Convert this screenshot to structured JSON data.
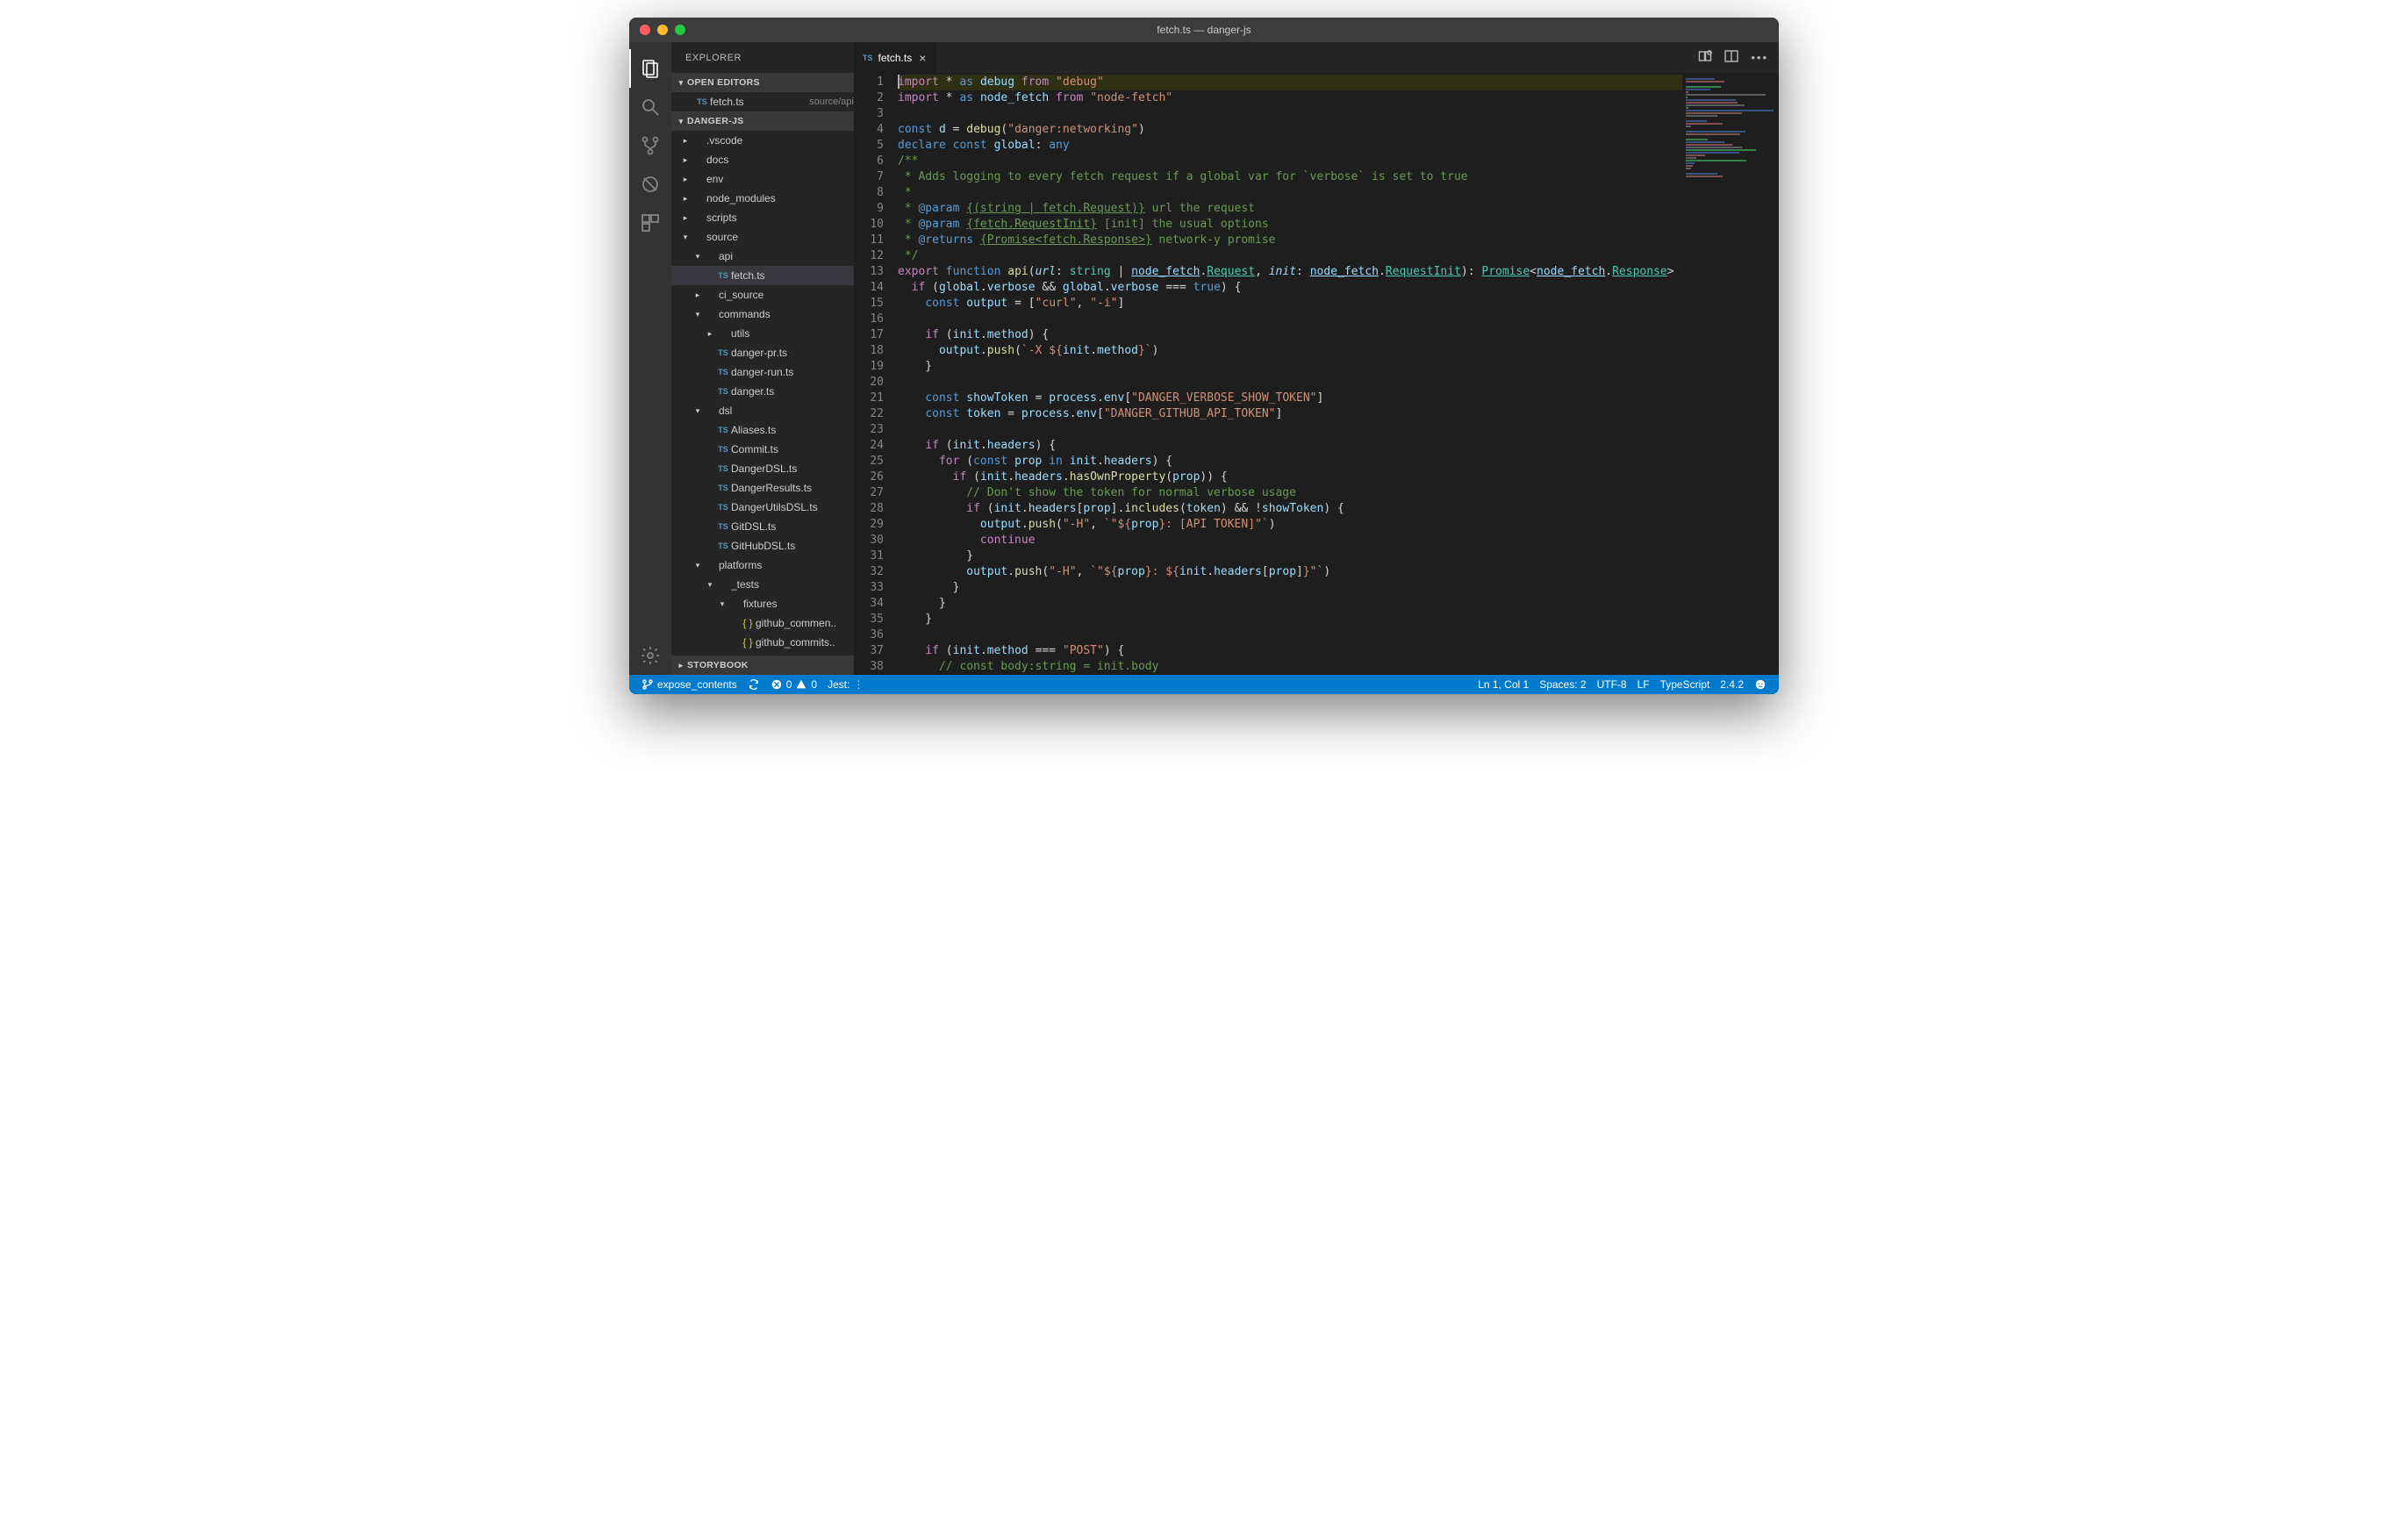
{
  "window": {
    "title": "fetch.ts — danger-js"
  },
  "sidebar": {
    "title": "EXPLORER",
    "sections": {
      "open_editors": {
        "label": "OPEN EDITORS",
        "items": [
          {
            "icon": "ts",
            "name": "fetch.ts",
            "path": "source/api"
          }
        ]
      },
      "project": {
        "label": "DANGER-JS"
      },
      "storybook": {
        "label": "STORYBOOK"
      }
    },
    "tree": [
      {
        "depth": 0,
        "kind": "folder",
        "open": false,
        "name": ".vscode"
      },
      {
        "depth": 0,
        "kind": "folder",
        "open": false,
        "name": "docs"
      },
      {
        "depth": 0,
        "kind": "folder",
        "open": false,
        "name": "env"
      },
      {
        "depth": 0,
        "kind": "folder",
        "open": false,
        "name": "node_modules"
      },
      {
        "depth": 0,
        "kind": "folder",
        "open": false,
        "name": "scripts"
      },
      {
        "depth": 0,
        "kind": "folder",
        "open": true,
        "name": "source"
      },
      {
        "depth": 1,
        "kind": "folder",
        "open": true,
        "name": "api"
      },
      {
        "depth": 2,
        "kind": "file",
        "icon": "ts",
        "name": "fetch.ts",
        "selected": true
      },
      {
        "depth": 1,
        "kind": "folder",
        "open": false,
        "name": "ci_source"
      },
      {
        "depth": 1,
        "kind": "folder",
        "open": true,
        "name": "commands"
      },
      {
        "depth": 2,
        "kind": "folder",
        "open": false,
        "name": "utils"
      },
      {
        "depth": 2,
        "kind": "file",
        "icon": "ts",
        "name": "danger-pr.ts"
      },
      {
        "depth": 2,
        "kind": "file",
        "icon": "ts",
        "name": "danger-run.ts"
      },
      {
        "depth": 2,
        "kind": "file",
        "icon": "ts",
        "name": "danger.ts"
      },
      {
        "depth": 1,
        "kind": "folder",
        "open": true,
        "name": "dsl"
      },
      {
        "depth": 2,
        "kind": "file",
        "icon": "ts",
        "name": "Aliases.ts"
      },
      {
        "depth": 2,
        "kind": "file",
        "icon": "ts",
        "name": "Commit.ts"
      },
      {
        "depth": 2,
        "kind": "file",
        "icon": "ts",
        "name": "DangerDSL.ts"
      },
      {
        "depth": 2,
        "kind": "file",
        "icon": "ts",
        "name": "DangerResults.ts"
      },
      {
        "depth": 2,
        "kind": "file",
        "icon": "ts",
        "name": "DangerUtilsDSL.ts"
      },
      {
        "depth": 2,
        "kind": "file",
        "icon": "ts",
        "name": "GitDSL.ts"
      },
      {
        "depth": 2,
        "kind": "file",
        "icon": "ts",
        "name": "GitHubDSL.ts"
      },
      {
        "depth": 1,
        "kind": "folder",
        "open": true,
        "name": "platforms"
      },
      {
        "depth": 2,
        "kind": "folder",
        "open": true,
        "name": "_tests"
      },
      {
        "depth": 3,
        "kind": "folder",
        "open": true,
        "name": "fixtures"
      },
      {
        "depth": 4,
        "kind": "file",
        "icon": "json",
        "name": "github_commen.."
      },
      {
        "depth": 4,
        "kind": "file",
        "icon": "json",
        "name": "github_commits.."
      }
    ]
  },
  "tabs": {
    "open": [
      {
        "icon": "ts",
        "name": "fetch.ts",
        "active": true
      }
    ]
  },
  "editor": {
    "lines": [
      {
        "n": 1,
        "hl": true,
        "html": "<span class='cursor'></span><span class='t-k'>import</span> <span class='t-op'>*</span> <span class='t-kw2'>as</span> <span class='t-v'>debug</span> <span class='t-k'>from</span> <span class='t-s'>\"debug\"</span>"
      },
      {
        "n": 2,
        "html": "<span class='t-k'>import</span> <span class='t-op'>*</span> <span class='t-kw2'>as</span> <span class='t-v'>node_fetch</span> <span class='t-k'>from</span> <span class='t-s'>\"node-fetch\"</span>"
      },
      {
        "n": 3,
        "html": ""
      },
      {
        "n": 4,
        "html": "<span class='t-kw2'>const</span> <span class='t-v'>d</span> <span class='t-op'>=</span> <span class='t-fn'>debug</span>(<span class='t-s'>\"danger:networking\"</span>)"
      },
      {
        "n": 5,
        "html": "<span class='t-kw2'>declare</span> <span class='t-kw2'>const</span> <span class='t-v'>global</span>: <span class='t-kw2'>any</span>"
      },
      {
        "n": 6,
        "html": "<span class='t-c'>/**</span>"
      },
      {
        "n": 7,
        "html": "<span class='t-c'> * Adds logging to every fetch request if a global var for `verbose` is set to true</span>"
      },
      {
        "n": 8,
        "html": "<span class='t-c'> *</span>"
      },
      {
        "n": 9,
        "html": "<span class='t-c'> * <span class='t-doctag'>@param</span> <span class='t-u'>{(string | fetch.Request)}</span> url the request</span>"
      },
      {
        "n": 10,
        "html": "<span class='t-c'> * <span class='t-doctag'>@param</span> <span class='t-u'>{fetch.RequestInit}</span> [init] the usual options</span>"
      },
      {
        "n": 11,
        "html": "<span class='t-c'> * <span class='t-doctag'>@returns</span> <span class='t-u'>{Promise&lt;fetch.Response&gt;}</span> network-y promise</span>"
      },
      {
        "n": 12,
        "html": "<span class='t-c'> */</span>"
      },
      {
        "n": 13,
        "html": "<span class='t-k'>export</span> <span class='t-kw2'>function</span> <span class='t-fn'>api</span>(<span class='t-v t-it'>url</span>: <span class='t-ty'>string</span> | <span class='t-v t-u'>node_fetch</span>.<span class='t-ty t-u'>Request</span>, <span class='t-v t-it'>init</span>: <span class='t-v t-u'>node_fetch</span>.<span class='t-ty t-u'>RequestInit</span>): <span class='t-ty t-u'>Promise</span>&lt;<span class='t-v t-u'>node_fetch</span>.<span class='t-ty t-u'>Response</span>&gt; <span class='t-br'>{</span>"
      },
      {
        "n": 14,
        "html": "  <span class='t-k'>if</span> (<span class='t-v'>global</span>.<span class='t-v'>verbose</span> <span class='t-op'>&amp;&amp;</span> <span class='t-v'>global</span>.<span class='t-v'>verbose</span> <span class='t-op'>===</span> <span class='t-kw2'>true</span>) {"
      },
      {
        "n": 15,
        "html": "    <span class='t-kw2'>const</span> <span class='t-v'>output</span> <span class='t-op'>=</span> [<span class='t-s'>\"curl\"</span>, <span class='t-s'>\"-i\"</span>]"
      },
      {
        "n": 16,
        "html": ""
      },
      {
        "n": 17,
        "html": "    <span class='t-k'>if</span> (<span class='t-v'>init</span>.<span class='t-v'>method</span>) {"
      },
      {
        "n": 18,
        "html": "      <span class='t-v'>output</span>.<span class='t-fn'>push</span>(<span class='t-s'>`-X ${</span><span class='t-v'>init</span>.<span class='t-v'>method</span><span class='t-s'>}`</span>)"
      },
      {
        "n": 19,
        "html": "    }"
      },
      {
        "n": 20,
        "html": ""
      },
      {
        "n": 21,
        "html": "    <span class='t-kw2'>const</span> <span class='t-v'>showToken</span> <span class='t-op'>=</span> <span class='t-v'>process</span>.<span class='t-v'>env</span>[<span class='t-s'>\"DANGER_VERBOSE_SHOW_TOKEN\"</span>]"
      },
      {
        "n": 22,
        "html": "    <span class='t-kw2'>const</span> <span class='t-v'>token</span> <span class='t-op'>=</span> <span class='t-v'>process</span>.<span class='t-v'>env</span>[<span class='t-s'>\"DANGER_GITHUB_API_TOKEN\"</span>]"
      },
      {
        "n": 23,
        "html": ""
      },
      {
        "n": 24,
        "html": "    <span class='t-k'>if</span> (<span class='t-v'>init</span>.<span class='t-v'>headers</span>) {"
      },
      {
        "n": 25,
        "html": "      <span class='t-k'>for</span> (<span class='t-kw2'>const</span> <span class='t-v'>prop</span> <span class='t-kw2'>in</span> <span class='t-v'>init</span>.<span class='t-v'>headers</span>) {"
      },
      {
        "n": 26,
        "html": "        <span class='t-k'>if</span> (<span class='t-v'>init</span>.<span class='t-v'>headers</span>.<span class='t-fn'>hasOwnProperty</span>(<span class='t-v'>prop</span>)) {"
      },
      {
        "n": 27,
        "html": "          <span class='t-c'>// Don't show the token for normal verbose usage</span>"
      },
      {
        "n": 28,
        "html": "          <span class='t-k'>if</span> (<span class='t-v'>init</span>.<span class='t-v'>headers</span>[<span class='t-v'>prop</span>].<span class='t-fn'>includes</span>(<span class='t-v'>token</span>) <span class='t-op'>&amp;&amp;</span> !<span class='t-v'>showToken</span>) {"
      },
      {
        "n": 29,
        "html": "            <span class='t-v'>output</span>.<span class='t-fn'>push</span>(<span class='t-s'>\"-H\"</span>, <span class='t-s'>`\"${</span><span class='t-v'>prop</span><span class='t-s'>}: [API TOKEN]\"`</span>)"
      },
      {
        "n": 30,
        "html": "            <span class='t-k'>continue</span>"
      },
      {
        "n": 31,
        "html": "          }"
      },
      {
        "n": 32,
        "html": "          <span class='t-v'>output</span>.<span class='t-fn'>push</span>(<span class='t-s'>\"-H\"</span>, <span class='t-s'>`\"${</span><span class='t-v'>prop</span><span class='t-s'>}: ${</span><span class='t-v'>init</span>.<span class='t-v'>headers</span>[<span class='t-v'>prop</span>]<span class='t-s'>}\"`</span>)"
      },
      {
        "n": 33,
        "html": "        }"
      },
      {
        "n": 34,
        "html": "      }"
      },
      {
        "n": 35,
        "html": "    }"
      },
      {
        "n": 36,
        "html": ""
      },
      {
        "n": 37,
        "html": "    <span class='t-k'>if</span> (<span class='t-v'>init</span>.<span class='t-v'>method</span> <span class='t-op'>===</span> <span class='t-s'>\"POST\"</span>) {"
      },
      {
        "n": 38,
        "html": "      <span class='t-c'>// const body:string = init.body</span>"
      }
    ]
  },
  "status": {
    "branch": "expose_contents",
    "errors": "0",
    "warnings": "0",
    "jest": "Jest:",
    "lncol": "Ln 1, Col 1",
    "spaces": "Spaces: 2",
    "encoding": "UTF-8",
    "eol": "LF",
    "language": "TypeScript",
    "version": "2.4.2"
  }
}
